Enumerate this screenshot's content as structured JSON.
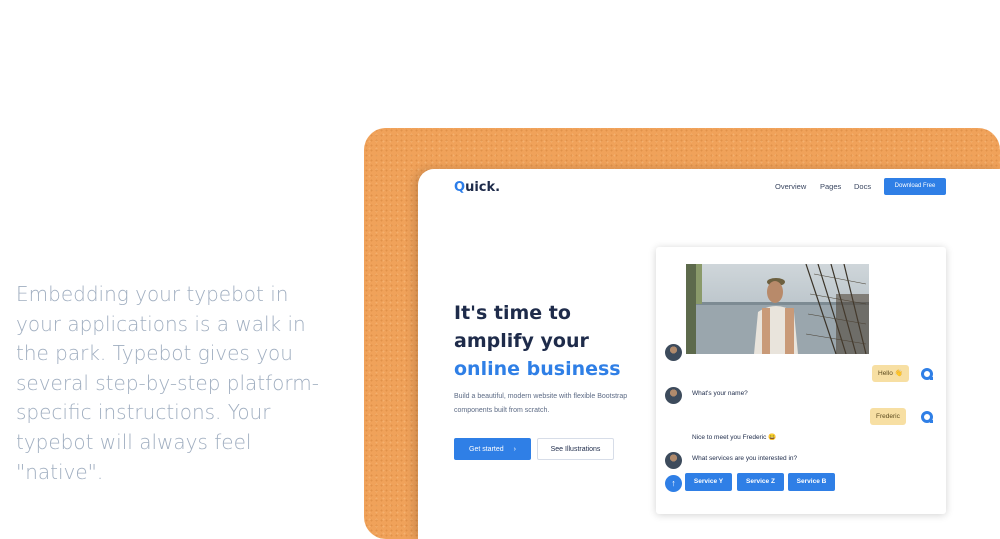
{
  "description": "Embedding your typebot in your applications is a walk in the park. Typebot gives you several step-by-step platform-specific instructions. Your typebot will always feel \"native\".",
  "site": {
    "logo_q": "Q",
    "logo_rest": "uick.",
    "nav": [
      "Overview",
      "Pages",
      "Docs"
    ],
    "download_label": "Download Free",
    "hero_line1": "It's time to",
    "hero_line2": "amplify your",
    "hero_accent": "online business",
    "subtitle": "Build a beautiful, modern website with flexible Bootstrap components built from scratch.",
    "get_started": "Get started",
    "get_started_arrow": "›",
    "see_illustrations": "See Illustrations"
  },
  "chat": {
    "user_hello": "Hello 👋",
    "bot_ask_name": "What's your name?",
    "user_name": "Frederic",
    "bot_greet": "Nice to meet you Frederic 😀",
    "bot_services": "What services are you interested in?",
    "services": [
      "Service Y",
      "Service Z",
      "Service B"
    ],
    "up_arrow": "↑"
  },
  "colors": {
    "accent": "#2f7fe6",
    "orange_frame": "#f0a25a",
    "description_text": "#a0aec0",
    "user_bubble": "#f7dfa3"
  }
}
